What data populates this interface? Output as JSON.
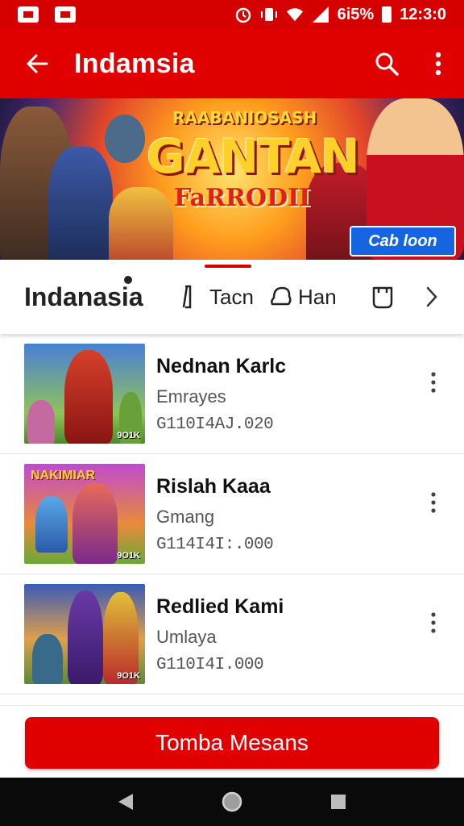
{
  "status_bar": {
    "battery": "6i5%",
    "time": "12:3:0"
  },
  "app_bar": {
    "title": "Indamsia"
  },
  "banner": {
    "kicker": "RAABANIOSASH",
    "title": "GANTAN",
    "subtitle": "FaRRODII",
    "button_label": "Cab loon"
  },
  "tabs": [
    {
      "label": "Indanasia",
      "active": true
    },
    {
      "label": "Tacn",
      "icon": "bracket-icon"
    },
    {
      "label": "Han",
      "icon": "bell-icon"
    },
    {
      "label": "",
      "icon": "badge-icon"
    }
  ],
  "list": [
    {
      "title": "Nednan Karlc",
      "subtitle": "Emrayes",
      "number": "G110I4AJ.020",
      "thumb_tag": "9O1K"
    },
    {
      "title": "Rislah Kaaa",
      "subtitle": "Gmang",
      "number": "G114I4I:.000",
      "thumb_title": "NAKIMIAR",
      "thumb_tag": "9O1K"
    },
    {
      "title": "Redlied Kami",
      "subtitle": "Umlaya",
      "number": "G110I4I.000",
      "thumb_tag": "9O1K"
    }
  ],
  "primary_button": {
    "label": "Tomba Mesans"
  },
  "colors": {
    "accent": "#e00000",
    "status_bar": "#d50000",
    "link_button": "#1565e0"
  }
}
